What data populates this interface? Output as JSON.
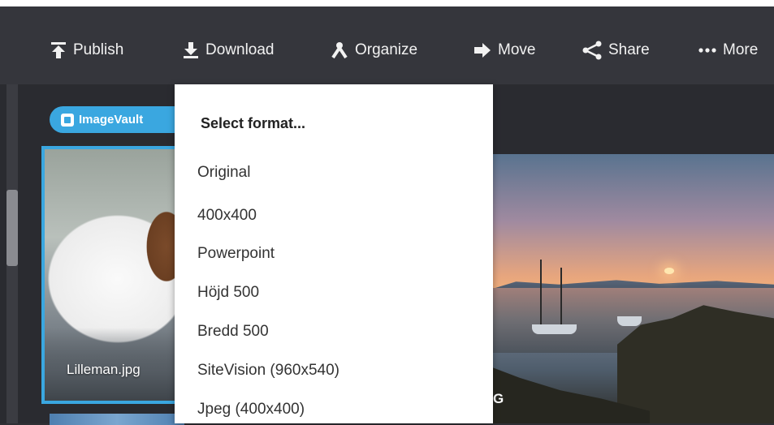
{
  "toolbar": {
    "items": [
      {
        "label": "Publish",
        "icon": "publish-icon"
      },
      {
        "label": "Download",
        "icon": "download-icon"
      },
      {
        "label": "Organize",
        "icon": "organize-icon"
      },
      {
        "label": "Move",
        "icon": "arrow-right-icon"
      },
      {
        "label": "Share",
        "icon": "share-icon"
      },
      {
        "label": "More",
        "icon": "more-dots-icon"
      }
    ]
  },
  "badge": {
    "label": "ImageVault"
  },
  "dropdown": {
    "header": "Select format...",
    "items": [
      "Original",
      "400x400",
      "Powerpoint",
      "Höjd 500",
      "Bredd 500",
      "SiteVision (960x540)",
      "Jpeg (400x400)"
    ]
  },
  "thumbnails": [
    {
      "caption": "Lilleman.jpg"
    },
    {
      "caption": "G"
    }
  ],
  "colors": {
    "toolbar_bg": "#35363c",
    "content_bg": "#2a2b30",
    "accent": "#3aa7e0",
    "dropdown_bg": "#ffffff"
  }
}
